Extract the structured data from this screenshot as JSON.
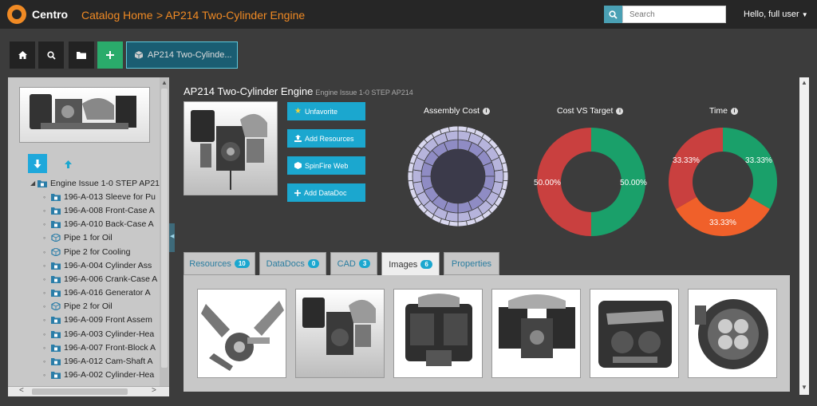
{
  "app": {
    "name": "Centro"
  },
  "breadcrumb": {
    "home": "Catalog Home",
    "current": "> AP214 Two-Cylinder Engine"
  },
  "search": {
    "placeholder": "Search"
  },
  "user": {
    "greeting": "Hello, full user"
  },
  "toolbar": {
    "active_tab": "AP214 Two-Cylinde..."
  },
  "tree": {
    "root": "Engine Issue 1-0 STEP AP21",
    "items": [
      {
        "label": "196-A-013 Sleeve for Pu",
        "icon": "assembly"
      },
      {
        "label": "196-A-008 Front-Case A",
        "icon": "assembly"
      },
      {
        "label": "196-A-010 Back-Case A",
        "icon": "assembly"
      },
      {
        "label": "Pipe 1 for Oil",
        "icon": "part"
      },
      {
        "label": "Pipe 2 for Cooling",
        "icon": "part"
      },
      {
        "label": "196-A-004 Cylinder Ass",
        "icon": "assembly"
      },
      {
        "label": "196-A-006 Crank-Case A",
        "icon": "assembly"
      },
      {
        "label": "196-A-016 Generator A",
        "icon": "assembly"
      },
      {
        "label": "Pipe 2 for Oil",
        "icon": "part"
      },
      {
        "label": "196-A-009 Front Assem",
        "icon": "assembly"
      },
      {
        "label": "196-A-003 Cylinder-Hea",
        "icon": "assembly"
      },
      {
        "label": "196-A-007 Front-Block A",
        "icon": "assembly"
      },
      {
        "label": "196-A-012 Cam-Shaft A",
        "icon": "assembly"
      },
      {
        "label": "196-A-002 Cylinder-Hea",
        "icon": "assembly"
      }
    ]
  },
  "main": {
    "title": "AP214 Two-Cylinder Engine",
    "subtitle": "Engine Issue 1-0 STEP AP214",
    "actions": [
      "Unfavorite",
      "Add Resources",
      "SpinFire Web",
      "Add DataDoc"
    ]
  },
  "chart_data": [
    {
      "type": "sunburst",
      "title": "Assembly Cost"
    },
    {
      "type": "pie",
      "title": "Cost VS Target",
      "labels": [
        "50.00%",
        "50.00%"
      ],
      "values": [
        50,
        50
      ],
      "colors": [
        "#1aa06a",
        "#c9403f"
      ]
    },
    {
      "type": "pie",
      "title": "Time",
      "labels": [
        "33.33%",
        "33.33%",
        "33.33%"
      ],
      "values": [
        33.33,
        33.33,
        33.33
      ],
      "colors": [
        "#1aa06a",
        "#f0602a",
        "#c9403f"
      ]
    }
  ],
  "tabs": [
    {
      "label": "Resources",
      "count": "10"
    },
    {
      "label": "DataDocs",
      "count": "0"
    },
    {
      "label": "CAD",
      "count": "3"
    },
    {
      "label": "Images",
      "count": "6"
    },
    {
      "label": "Properties",
      "count": ""
    }
  ],
  "colors": {
    "accent": "#f08a24",
    "action": "#1ba7cf",
    "green": "#2aab6b"
  }
}
